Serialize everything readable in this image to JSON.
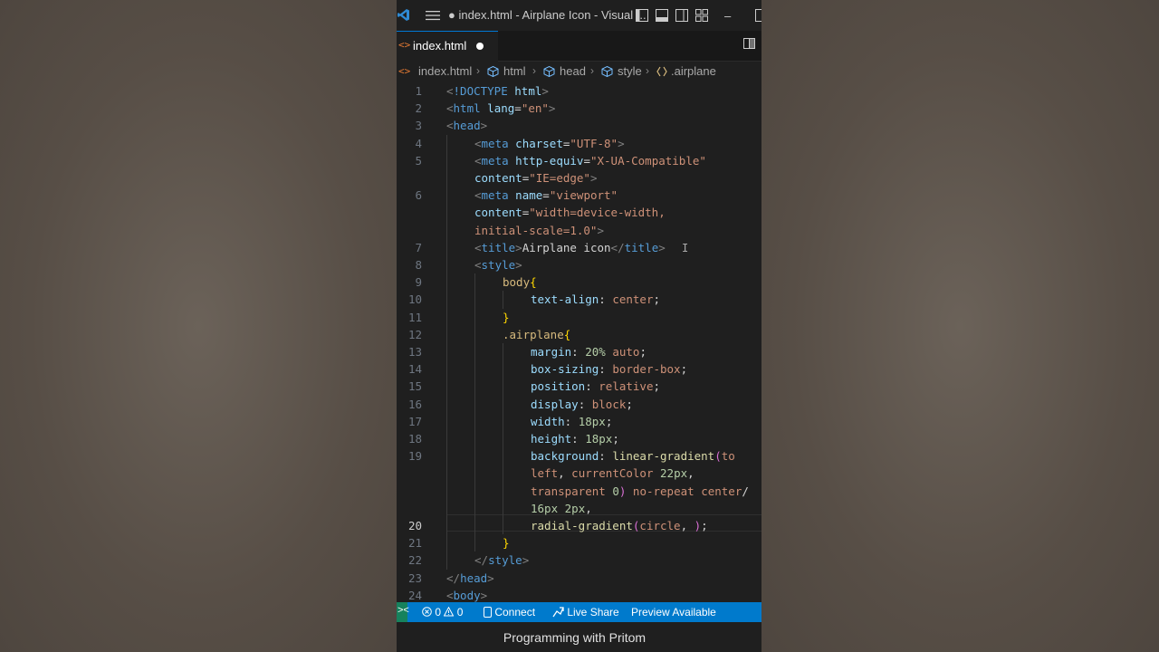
{
  "window": {
    "title": "● index.html - Airplane Icon - Visual ...",
    "minimize_glyph": "–"
  },
  "tab": {
    "icon": "<>",
    "label": "index.html"
  },
  "breadcrumb": {
    "icon": "<>",
    "items": [
      "index.html",
      "html",
      "head",
      "style",
      ".airplane"
    ]
  },
  "editor": {
    "active_line": 20,
    "lines": [
      {
        "n": "1",
        "indent": 0,
        "tokens": [
          [
            "t-tag",
            "<"
          ],
          [
            "t-name",
            "!DOCTYPE"
          ],
          [
            "t-text",
            " "
          ],
          [
            "t-attr",
            "html"
          ],
          [
            "t-tag",
            ">"
          ]
        ]
      },
      {
        "n": "2",
        "indent": 0,
        "tokens": [
          [
            "t-tag",
            "<"
          ],
          [
            "t-name",
            "html"
          ],
          [
            "t-text",
            " "
          ],
          [
            "t-attr",
            "lang"
          ],
          [
            "t-text",
            "="
          ],
          [
            "t-str",
            "\"en\""
          ],
          [
            "t-tag",
            ">"
          ]
        ]
      },
      {
        "n": "3",
        "indent": 0,
        "tokens": [
          [
            "t-tag",
            "<"
          ],
          [
            "t-name",
            "head"
          ],
          [
            "t-tag",
            ">"
          ]
        ]
      },
      {
        "n": "4",
        "indent": 1,
        "tokens": [
          [
            "t-tag",
            "<"
          ],
          [
            "t-name",
            "meta"
          ],
          [
            "t-text",
            " "
          ],
          [
            "t-attr",
            "charset"
          ],
          [
            "t-text",
            "="
          ],
          [
            "t-str",
            "\"UTF-8\""
          ],
          [
            "t-tag",
            ">"
          ]
        ]
      },
      {
        "n": "5",
        "indent": 1,
        "tokens": [
          [
            "t-tag",
            "<"
          ],
          [
            "t-name",
            "meta"
          ],
          [
            "t-text",
            " "
          ],
          [
            "t-attr",
            "http-equiv"
          ],
          [
            "t-text",
            "="
          ],
          [
            "t-str",
            "\"X-UA-Compatible\""
          ]
        ]
      },
      {
        "n": "",
        "indent": 1,
        "tokens": [
          [
            "t-attr",
            "content"
          ],
          [
            "t-text",
            "="
          ],
          [
            "t-str",
            "\"IE=edge\""
          ],
          [
            "t-tag",
            ">"
          ]
        ]
      },
      {
        "n": "6",
        "indent": 1,
        "tokens": [
          [
            "t-tag",
            "<"
          ],
          [
            "t-name",
            "meta"
          ],
          [
            "t-text",
            " "
          ],
          [
            "t-attr",
            "name"
          ],
          [
            "t-text",
            "="
          ],
          [
            "t-str",
            "\"viewport\""
          ]
        ]
      },
      {
        "n": "",
        "indent": 1,
        "tokens": [
          [
            "t-attr",
            "content"
          ],
          [
            "t-text",
            "="
          ],
          [
            "t-str",
            "\"width=device-width,"
          ]
        ]
      },
      {
        "n": "",
        "indent": 1,
        "tokens": [
          [
            "t-str",
            "initial-scale=1.0\""
          ],
          [
            "t-tag",
            ">"
          ]
        ]
      },
      {
        "n": "7",
        "indent": 1,
        "tokens": [
          [
            "t-tag",
            "<"
          ],
          [
            "t-name",
            "title"
          ],
          [
            "t-tag",
            ">"
          ],
          [
            "t-text",
            "Airplane icon"
          ],
          [
            "t-tag",
            "</"
          ],
          [
            "t-name",
            "title"
          ],
          [
            "t-tag",
            ">"
          ]
        ]
      },
      {
        "n": "8",
        "indent": 1,
        "tokens": [
          [
            "t-tag",
            "<"
          ],
          [
            "t-name",
            "style"
          ],
          [
            "t-tag",
            ">"
          ]
        ]
      },
      {
        "n": "9",
        "indent": 2,
        "tokens": [
          [
            "t-sel",
            "body"
          ],
          [
            "t-br1",
            "{"
          ]
        ]
      },
      {
        "n": "10",
        "indent": 3,
        "tokens": [
          [
            "t-prop",
            "text-align"
          ],
          [
            "t-text",
            ": "
          ],
          [
            "t-val",
            "center"
          ],
          [
            "t-text",
            ";"
          ]
        ]
      },
      {
        "n": "11",
        "indent": 2,
        "tokens": [
          [
            "t-br1",
            "}"
          ]
        ]
      },
      {
        "n": "12",
        "indent": 2,
        "tokens": [
          [
            "t-sel",
            ".airplane"
          ],
          [
            "t-br1",
            "{"
          ]
        ]
      },
      {
        "n": "13",
        "indent": 3,
        "tokens": [
          [
            "t-prop",
            "margin"
          ],
          [
            "t-text",
            ": "
          ],
          [
            "t-num",
            "20%"
          ],
          [
            "t-text",
            " "
          ],
          [
            "t-val",
            "auto"
          ],
          [
            "t-text",
            ";"
          ]
        ]
      },
      {
        "n": "14",
        "indent": 3,
        "tokens": [
          [
            "t-prop",
            "box-sizing"
          ],
          [
            "t-text",
            ": "
          ],
          [
            "t-val",
            "border-box"
          ],
          [
            "t-text",
            ";"
          ]
        ]
      },
      {
        "n": "15",
        "indent": 3,
        "tokens": [
          [
            "t-prop",
            "position"
          ],
          [
            "t-text",
            ": "
          ],
          [
            "t-val",
            "relative"
          ],
          [
            "t-text",
            ";"
          ]
        ]
      },
      {
        "n": "16",
        "indent": 3,
        "tokens": [
          [
            "t-prop",
            "display"
          ],
          [
            "t-text",
            ": "
          ],
          [
            "t-val",
            "block"
          ],
          [
            "t-text",
            ";"
          ]
        ]
      },
      {
        "n": "17",
        "indent": 3,
        "tokens": [
          [
            "t-prop",
            "width"
          ],
          [
            "t-text",
            ": "
          ],
          [
            "t-num",
            "18px"
          ],
          [
            "t-text",
            ";"
          ]
        ]
      },
      {
        "n": "18",
        "indent": 3,
        "tokens": [
          [
            "t-prop",
            "height"
          ],
          [
            "t-text",
            ": "
          ],
          [
            "t-num",
            "18px"
          ],
          [
            "t-text",
            ";"
          ]
        ]
      },
      {
        "n": "19",
        "indent": 3,
        "tokens": [
          [
            "t-prop",
            "background"
          ],
          [
            "t-text",
            ": "
          ],
          [
            "t-fn",
            "linear-gradient"
          ],
          [
            "t-br2",
            "("
          ],
          [
            "t-val",
            "to"
          ]
        ]
      },
      {
        "n": "",
        "indent": 3,
        "tokens": [
          [
            "t-val",
            "left"
          ],
          [
            "t-text",
            ", "
          ],
          [
            "t-val",
            "currentColor"
          ],
          [
            "t-text",
            " "
          ],
          [
            "t-num",
            "22px"
          ],
          [
            "t-text",
            ","
          ]
        ]
      },
      {
        "n": "",
        "indent": 3,
        "tokens": [
          [
            "t-val",
            "transparent"
          ],
          [
            "t-text",
            " "
          ],
          [
            "t-num",
            "0"
          ],
          [
            "t-br2",
            ")"
          ],
          [
            "t-text",
            " "
          ],
          [
            "t-val",
            "no-repeat"
          ],
          [
            "t-text",
            " "
          ],
          [
            "t-val",
            "center"
          ],
          [
            "t-text",
            "/"
          ]
        ]
      },
      {
        "n": "",
        "indent": 3,
        "tokens": [
          [
            "t-num",
            "16px"
          ],
          [
            "t-text",
            " "
          ],
          [
            "t-num",
            "2px"
          ],
          [
            "t-text",
            ","
          ]
        ]
      },
      {
        "n": "20",
        "indent": 3,
        "tokens": [
          [
            "t-fn",
            "radial-gradient"
          ],
          [
            "t-br2",
            "("
          ],
          [
            "t-val",
            "circle"
          ],
          [
            "t-text",
            ", "
          ],
          [
            "t-br2",
            ")"
          ],
          [
            "t-text",
            ";"
          ]
        ]
      },
      {
        "n": "21",
        "indent": 2,
        "tokens": [
          [
            "t-br1",
            "}"
          ]
        ]
      },
      {
        "n": "22",
        "indent": 1,
        "tokens": [
          [
            "t-tag",
            "</"
          ],
          [
            "t-name",
            "style"
          ],
          [
            "t-tag",
            ">"
          ]
        ]
      },
      {
        "n": "23",
        "indent": 0,
        "tokens": [
          [
            "t-tag",
            "</"
          ],
          [
            "t-name",
            "head"
          ],
          [
            "t-tag",
            ">"
          ]
        ]
      },
      {
        "n": "24",
        "indent": 0,
        "tokens": [
          [
            "t-tag",
            "<"
          ],
          [
            "t-name",
            "body"
          ],
          [
            "t-tag",
            ">"
          ]
        ]
      }
    ]
  },
  "statusbar": {
    "remote_glyph": "><",
    "problems_errors": "0",
    "problems_warnings": "0",
    "connect": "Connect",
    "live_share": "Live Share",
    "preview": "Preview Available"
  },
  "footer": {
    "caption": "Programming with Pritom"
  },
  "colors": {
    "accent": "#007acc",
    "editor_bg": "#1f1f1f",
    "remote": "#16825d"
  }
}
